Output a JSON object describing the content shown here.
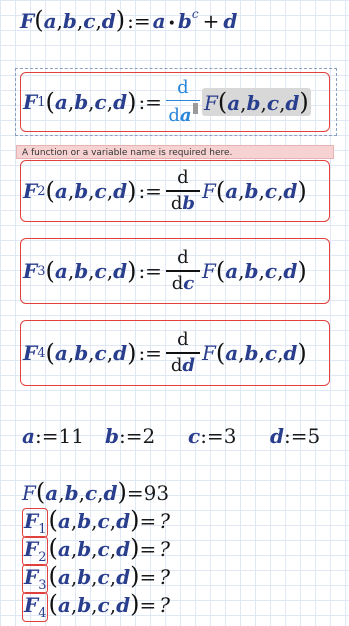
{
  "definition": {
    "lhs_func": "F",
    "args": [
      "a",
      "b",
      "c",
      "d"
    ],
    "assign": ":=",
    "rhs": {
      "a": "a",
      "dot": "•",
      "b": "b",
      "exp": "c",
      "plus": "+",
      "d": "d"
    }
  },
  "derivatives": [
    {
      "func": "F",
      "sub": "1",
      "num": "d",
      "den_prefix": "d",
      "den_var": "a",
      "rhs_func": "F",
      "active": true
    },
    {
      "func": "F",
      "sub": "2",
      "num": "d",
      "den_prefix": "d",
      "den_var": "b",
      "rhs_func": "F",
      "active": false
    },
    {
      "func": "F",
      "sub": "3",
      "num": "d",
      "den_prefix": "d",
      "den_var": "c",
      "rhs_func": "F",
      "active": false
    },
    {
      "func": "F",
      "sub": "4",
      "num": "d",
      "den_prefix": "d",
      "den_var": "d",
      "rhs_func": "F",
      "active": false
    }
  ],
  "error_tooltip": "A function or a variable name is required here.",
  "assignments": [
    {
      "var": "a",
      "op": ":=",
      "value": "11"
    },
    {
      "var": "b",
      "op": ":=",
      "value": "2"
    },
    {
      "var": "c",
      "op": ":=",
      "value": "3"
    },
    {
      "var": "d",
      "op": ":=",
      "value": "5"
    }
  ],
  "evaluations": [
    {
      "func": "F",
      "sub": "",
      "eq": "=",
      "result": "93",
      "error": false
    },
    {
      "func": "F",
      "sub": "1",
      "eq": "=",
      "result": "?",
      "error": true
    },
    {
      "func": "F",
      "sub": "2",
      "eq": "=",
      "result": "?",
      "error": true
    },
    {
      "func": "F",
      "sub": "3",
      "eq": "=",
      "result": "?",
      "error": true
    },
    {
      "func": "F",
      "sub": "4",
      "eq": "=",
      "result": "?",
      "error": true
    }
  ],
  "colors": {
    "variable": "#2a3e8e",
    "error_border": "#e0413c",
    "active_fraction": "#2b86d8",
    "tooltip_bg": "#f7d2d2",
    "grid": "#dfe8f4"
  }
}
